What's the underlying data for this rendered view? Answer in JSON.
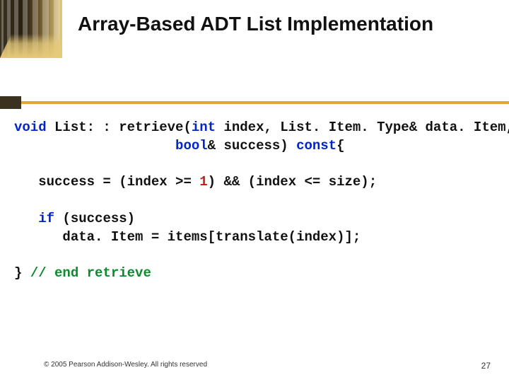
{
  "title": "Array-Based ADT List Implementation",
  "code": {
    "l1": {
      "kw1": "void",
      "t1": " List: : retrieve(",
      "kw2": "int",
      "t2": " index, List. Item. Type& data. Item,"
    },
    "l2": {
      "sp": "                    ",
      "kw1": "bool",
      "t1": "& success) ",
      "kw2": "const",
      "t2": "{"
    },
    "l3": {
      "sp": "   ",
      "t1": "success = (index >= ",
      "n1": "1",
      "t2": ") && (index <= size);"
    },
    "l4": {
      "sp": "   ",
      "kw1": "if",
      "t1": " (success)"
    },
    "l5": {
      "sp": "      ",
      "t1": "data. Item = items[translate(index)];"
    },
    "l6": {
      "t1": "} ",
      "c1": "// end retrieve"
    }
  },
  "footer": {
    "copyright": "© 2005 Pearson Addison-Wesley. All rights reserved",
    "page": "27"
  }
}
